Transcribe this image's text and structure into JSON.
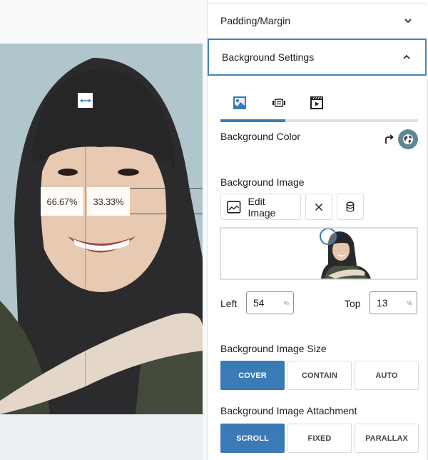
{
  "canvas": {
    "guides": {
      "left_percent_label": "66.67%",
      "right_percent_label": "33.33%"
    }
  },
  "panel": {
    "accordions": [
      {
        "label": "Padding/Margin",
        "expanded": false
      },
      {
        "label": "Background Settings",
        "expanded": true
      }
    ],
    "background_tabs": {
      "items": [
        {
          "name": "image",
          "icon": "image-icon",
          "active": true
        },
        {
          "name": "gradient",
          "icon": "slider-icon",
          "active": false
        },
        {
          "name": "video",
          "icon": "video-icon",
          "active": false
        }
      ],
      "progress": 0.33
    },
    "background_color": {
      "label": "Background Color",
      "reset_icon": "reset-arrow-icon",
      "global_icon": "globe-icon"
    },
    "background_image": {
      "label": "Background Image",
      "edit_button_label": "Edit Image",
      "remove_icon": "close-icon",
      "dynamic_icon": "database-icon",
      "focal_point": {
        "left": "54",
        "top": "13",
        "unit": "%"
      },
      "left_label": "Left",
      "top_label": "Top"
    },
    "image_size": {
      "label": "Background Image Size",
      "options": [
        "COVER",
        "CONTAIN",
        "AUTO"
      ],
      "selected": "COVER"
    },
    "image_attachment": {
      "label": "Background Image Attachment",
      "options": [
        "SCROLL",
        "FIXED",
        "PARALLAX"
      ],
      "selected": "SCROLL"
    }
  },
  "colors": {
    "accent": "#3a7ab7",
    "accordion_focus": "#4a84c0",
    "globe_button": "#5f8897",
    "photo_backdrop": "#b1c6cc"
  }
}
